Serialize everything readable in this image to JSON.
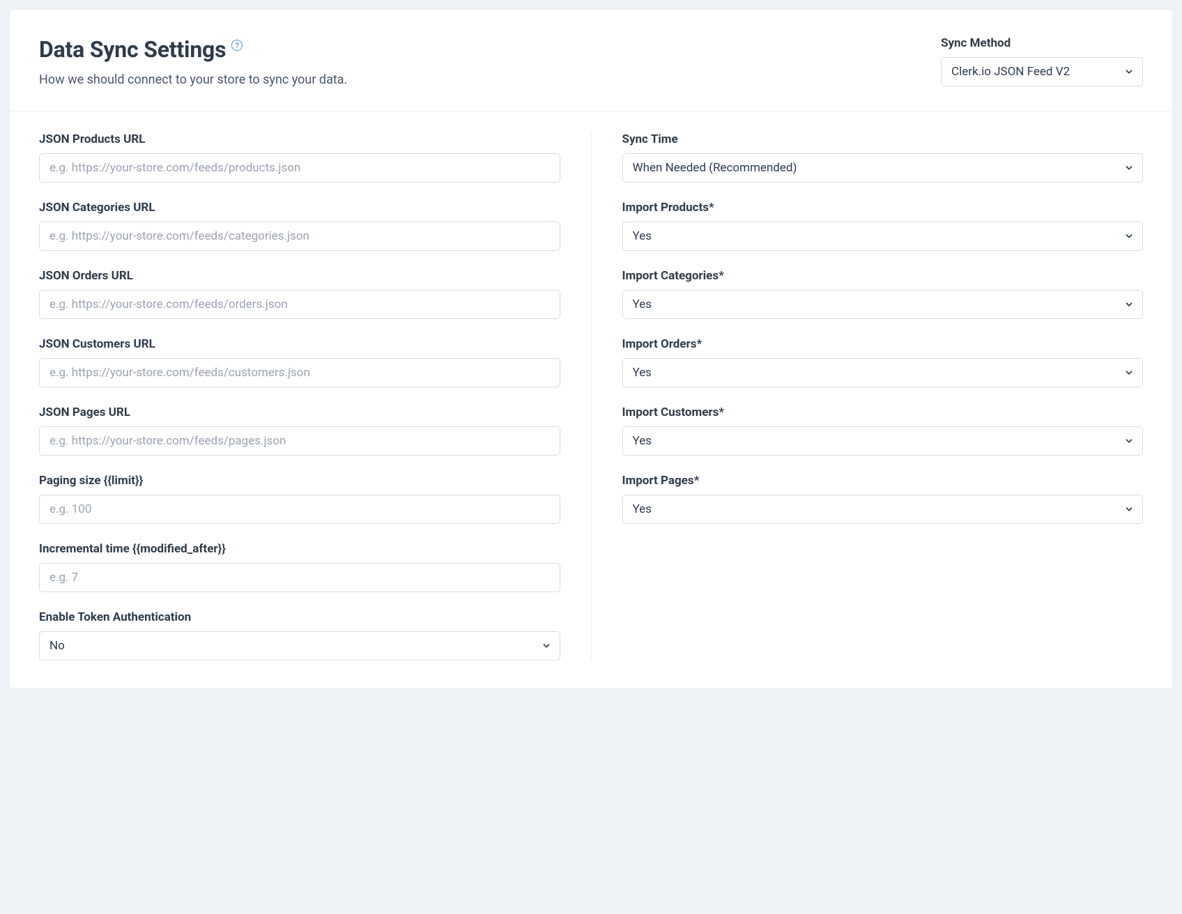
{
  "header": {
    "title": "Data Sync Settings",
    "subtitle": "How we should connect to your store to sync your data.",
    "sync_method": {
      "label": "Sync Method",
      "value": "Clerk.io JSON Feed V2"
    }
  },
  "left": {
    "products_url": {
      "label": "JSON Products URL",
      "placeholder": "e.g. https://your-store.com/feeds/products.json",
      "value": ""
    },
    "categories_url": {
      "label": "JSON Categories URL",
      "placeholder": "e.g. https://your-store.com/feeds/categories.json",
      "value": ""
    },
    "orders_url": {
      "label": "JSON Orders URL",
      "placeholder": "e.g. https://your-store.com/feeds/orders.json",
      "value": ""
    },
    "customers_url": {
      "label": "JSON Customers URL",
      "placeholder": "e.g. https://your-store.com/feeds/customers.json",
      "value": ""
    },
    "pages_url": {
      "label": "JSON Pages URL",
      "placeholder": "e.g. https://your-store.com/feeds/pages.json",
      "value": ""
    },
    "paging_size": {
      "label": "Paging size {{limit}}",
      "placeholder": "e.g. 100",
      "value": ""
    },
    "incremental_time": {
      "label": "Incremental time {{modified_after}}",
      "placeholder": "e.g. 7",
      "value": ""
    },
    "token_auth": {
      "label": "Enable Token Authentication",
      "value": "No"
    }
  },
  "right": {
    "sync_time": {
      "label": "Sync Time",
      "value": "When Needed (Recommended)"
    },
    "import_products": {
      "label": "Import Products*",
      "value": "Yes"
    },
    "import_categories": {
      "label": "Import Categories*",
      "value": "Yes"
    },
    "import_orders": {
      "label": "Import Orders*",
      "value": "Yes"
    },
    "import_customers": {
      "label": "Import Customers*",
      "value": "Yes"
    },
    "import_pages": {
      "label": "Import Pages*",
      "value": "Yes"
    }
  }
}
